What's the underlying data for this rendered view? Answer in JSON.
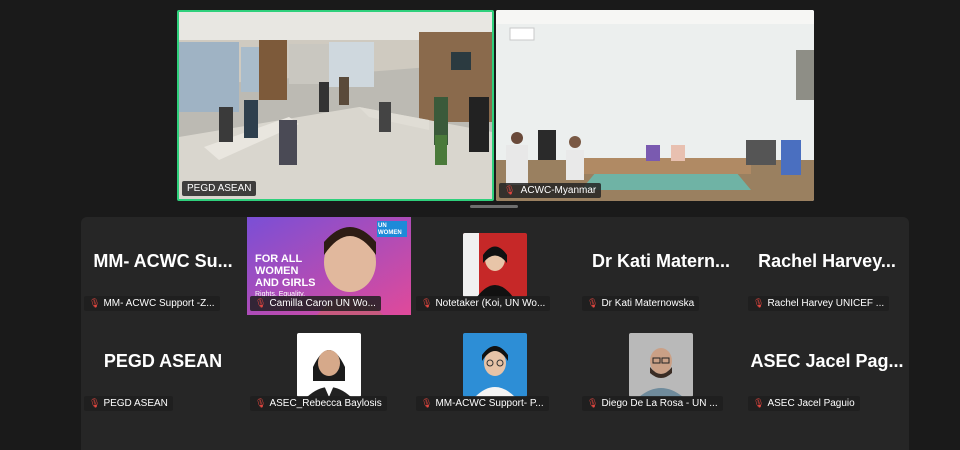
{
  "screen_share": {
    "left_tile": {
      "label": "PEGD ASEAN"
    },
    "right_tile": {
      "label": "ACWC-Myanmar"
    }
  },
  "icons": {
    "muted": "mic-muted-icon"
  },
  "colors": {
    "active_speaker_border": "#2fd07c",
    "muted_icon": "#e2463f",
    "gallery_bg": "#262626"
  },
  "participants": [
    {
      "display_name": "MM- ACWC Su...",
      "label": "MM- ACWC Support -Z..."
    },
    {
      "label": "Camilla Caron UN Wo...",
      "banner": {
        "line1": "FOR ALL",
        "line2": "WOMEN",
        "line3": "AND GIRLS",
        "line4": "Rights. Equality.",
        "badge": "UN WOMEN"
      }
    },
    {
      "label": "Notetaker (Koi, UN Wo..."
    },
    {
      "display_name": "Dr Kati Matern...",
      "label": "Dr Kati Maternowska"
    },
    {
      "display_name": "Rachel Harvey...",
      "label": "Rachel Harvey UNICEF ..."
    },
    {
      "display_name": "PEGD ASEAN",
      "label": "PEGD ASEAN"
    },
    {
      "label": "ASEC_Rebecca Baylosis"
    },
    {
      "label": "MM-ACWC Support- P..."
    },
    {
      "label": "Diego De La Rosa - UN ..."
    },
    {
      "display_name": "ASEC Jacel Pag...",
      "label": "ASEC Jacel Paguio"
    }
  ]
}
